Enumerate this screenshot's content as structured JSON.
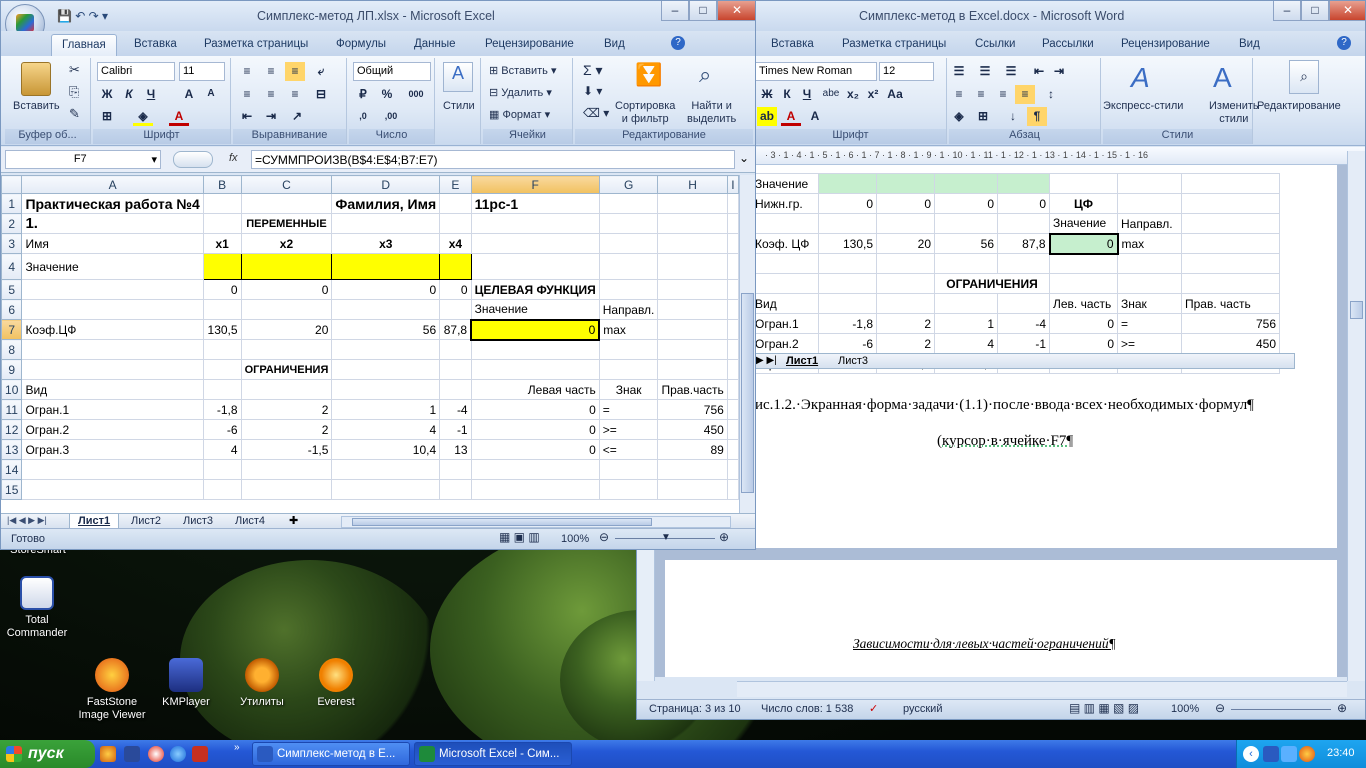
{
  "excel": {
    "title": "Симплекс-метод ЛП.xlsx - Microsoft Excel",
    "tabs": [
      "Главная",
      "Вставка",
      "Разметка страницы",
      "Формулы",
      "Данные",
      "Рецензирование",
      "Вид"
    ],
    "font_name": "Calibri",
    "font_size": "11",
    "number_format": "Общий",
    "groups": [
      "Буфер об...",
      "Шрифт",
      "Выравнивание",
      "Число",
      "Ячейки",
      "Редактирование"
    ],
    "paste_label": "Вставить",
    "styles_label": "Стили",
    "insert_label": "Вставить",
    "delete_label": "Удалить",
    "format_label": "Формат",
    "sort_label": "Сортировка\nи фильтр",
    "find_label": "Найти и\nвыделить",
    "name_box": "F7",
    "fx": "fx",
    "formula": "=СУММПРОИЗВ(B$4:E$4;B7:E7)",
    "columns": [
      "A",
      "B",
      "C",
      "D",
      "E",
      "F",
      "G",
      "H",
      "I"
    ],
    "rows": [
      [
        "Практическая работа №4",
        "",
        "",
        "Фамилия, Имя",
        "",
        "11рс-1",
        "",
        "",
        ""
      ],
      [
        "1.",
        "",
        "ПЕРЕМЕННЫЕ",
        "",
        "",
        "",
        "",
        "",
        ""
      ],
      [
        "Имя",
        "x1",
        "x2",
        "x3",
        "x4",
        "",
        "",
        "",
        ""
      ],
      [
        "Значение",
        "",
        "",
        "",
        "",
        "",
        "",
        "",
        ""
      ],
      [
        "",
        "0",
        "0",
        "0",
        "0",
        "ЦЕЛЕВАЯ ФУНКЦИЯ",
        "",
        "",
        ""
      ],
      [
        "",
        "",
        "",
        "",
        "",
        "Значение",
        "Направл.",
        "",
        ""
      ],
      [
        "Коэф.ЦФ",
        "130,5",
        "20",
        "56",
        "87,8",
        "0",
        "max",
        "",
        ""
      ],
      [
        "",
        "",
        "",
        "",
        "",
        "",
        "",
        "",
        ""
      ],
      [
        "",
        "",
        "ОГРАНИЧЕНИЯ",
        "",
        "",
        "",
        "",
        "",
        ""
      ],
      [
        "Вид",
        "",
        "",
        "",
        "",
        "Левая часть",
        "Знак",
        "Прав.часть",
        ""
      ],
      [
        "Огран.1",
        "-1,8",
        "2",
        "1",
        "-4",
        "0",
        "=",
        "756",
        ""
      ],
      [
        "Огран.2",
        "-6",
        "2",
        "4",
        "-1",
        "0",
        ">=",
        "450",
        ""
      ],
      [
        "Огран.3",
        "4",
        "-1,5",
        "10,4",
        "13",
        "0",
        "<=",
        "89",
        ""
      ],
      [
        "",
        "",
        "",
        "",
        "",
        "",
        "",
        "",
        ""
      ],
      [
        "",
        "",
        "",
        "",
        "",
        "",
        "",
        "",
        ""
      ]
    ],
    "sheets": [
      "Лист1",
      "Лист2",
      "Лист3",
      "Лист4"
    ],
    "status": "Готово",
    "zoom": "100%"
  },
  "word": {
    "title": "Симплекс-метод в Excel.docx - Microsoft Word",
    "tabs": [
      "Вставка",
      "Разметка страницы",
      "Ссылки",
      "Рассылки",
      "Рецензирование",
      "Вид"
    ],
    "font_name": "Times New Roman",
    "font_size": "12",
    "groups": [
      "Шрифт",
      "Абзац",
      "Стили"
    ],
    "express_styles": "Экспресс-стили",
    "change_styles": "Изменить\nстили",
    "editing": "Редактирование",
    "ruler": "· 3 · 1 · 4 · 1 · 5 · 1 · 6 · 1 · 7 · 1 · 8 · 1 · 9 · 1 · 10 · 1 · 11 · 1 · 12 · 1 · 13 · 1 · 14 · 1 · 15 · 1 · 16",
    "embedded": {
      "row_value": "Значение",
      "lower_row": [
        "Нижн.гр.",
        "0",
        "0",
        "0",
        "0"
      ],
      "cf_title": "ЦФ",
      "cf_headers": [
        "Значение",
        "Направл."
      ],
      "coef_row": [
        "Коэф. ЦФ",
        "130,5",
        "20",
        "56",
        "87,8",
        "0",
        "max"
      ],
      "constraints_title": "ОГРАНИЧЕНИЯ",
      "constraints_header": [
        "Вид",
        "",
        "",
        "",
        "",
        "Лев. часть",
        "Знак",
        "Прав. часть"
      ],
      "constraints": [
        [
          "Огран.1",
          "-1,8",
          "2",
          "1",
          "-4",
          "0",
          "=",
          "756"
        ],
        [
          "Огран.2",
          "-6",
          "2",
          "4",
          "-1",
          "0",
          ">=",
          "450"
        ],
        [
          "Огран.3",
          "4",
          "-1,5",
          "10,4",
          "13",
          "0",
          "<=",
          "89"
        ]
      ],
      "sheet_tabs": [
        "Лист1",
        "Лист3"
      ]
    },
    "caption": "ис.1.2.·Экранная·форма·задачи·(1.1)·после·ввода·всех·необходимых·формул¶",
    "caption2": "(курсор·в·ячейке·F7¶",
    "page2_text": "Зависимости·для·левых·частей·ограничений¶",
    "status_page": "Страница: 3 из 10",
    "status_words": "Число слов: 1 538",
    "status_lang": "русский",
    "zoom": "100%"
  },
  "desktop": {
    "icons": [
      {
        "label": "Total\nCommander"
      },
      {
        "label": "FastStone\nImage Viewer"
      },
      {
        "label": "KMPlayer"
      },
      {
        "label": "Утилиты"
      },
      {
        "label": "Everest"
      }
    ],
    "partial_label": "StoreSmart"
  },
  "taskbar": {
    "start": "пуск",
    "items": [
      "Симплекс-метод в E...",
      "Microsoft Excel - Сим..."
    ],
    "lang": "EN",
    "time": "23:40"
  }
}
